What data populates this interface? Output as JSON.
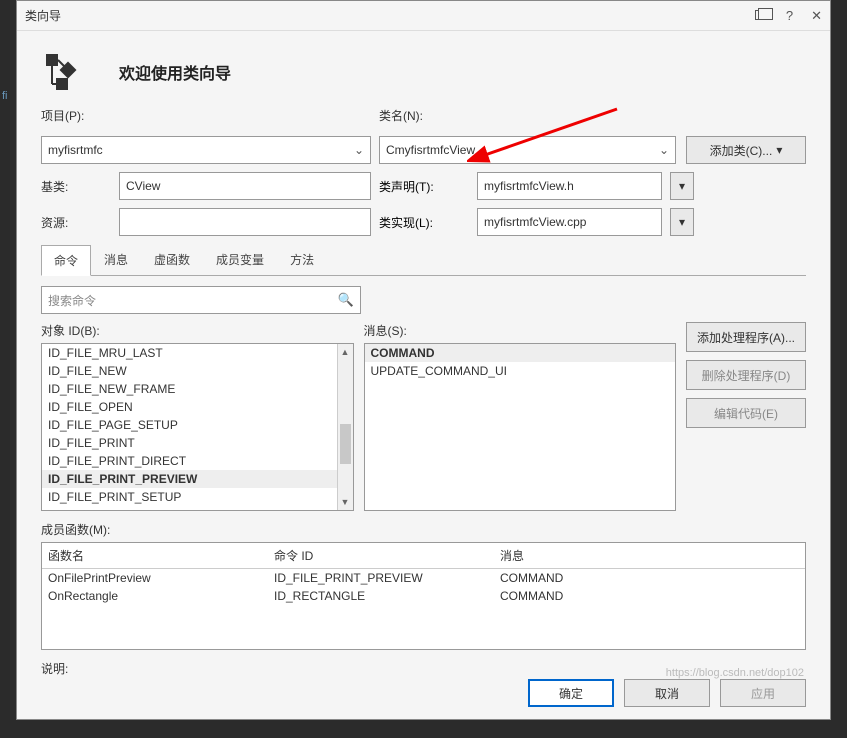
{
  "window": {
    "title": "类向导",
    "help_glyph": "?",
    "close_glyph": "✕"
  },
  "header": {
    "heading": "欢迎使用类向导"
  },
  "project": {
    "label": "项目(P):",
    "value": "myfisrtmfc"
  },
  "classname": {
    "label": "类名(N):",
    "value": "CmyfisrtmfcView"
  },
  "addclass_label": "添加类(C)...",
  "baseclass": {
    "label": "基类:",
    "value": "CView"
  },
  "decl": {
    "label": "类声明(T):",
    "value": "myfisrtmfcView.h"
  },
  "resource": {
    "label": "资源:",
    "value": ""
  },
  "impl": {
    "label": "类实现(L):",
    "value": "myfisrtmfcView.cpp"
  },
  "tabs": {
    "cmd": "命令",
    "msg": "消息",
    "virt": "虚函数",
    "memvar": "成员变量",
    "method": "方法"
  },
  "search": {
    "placeholder": "搜索命令"
  },
  "objectid": {
    "label": "对象 ID(B):",
    "items": [
      "ID_FILE_MRU_LAST",
      "ID_FILE_NEW",
      "ID_FILE_NEW_FRAME",
      "ID_FILE_OPEN",
      "ID_FILE_PAGE_SETUP",
      "ID_FILE_PRINT",
      "ID_FILE_PRINT_DIRECT",
      "ID_FILE_PRINT_PREVIEW",
      "ID_FILE_PRINT_SETUP"
    ],
    "selected_index": 7
  },
  "messages": {
    "label": "消息(S):",
    "items": [
      "COMMAND",
      "UPDATE_COMMAND_UI"
    ],
    "selected_index": 0
  },
  "side_buttons": {
    "add_handler": "添加处理程序(A)...",
    "del_handler": "删除处理程序(D)",
    "edit_code": "编辑代码(E)"
  },
  "members": {
    "label": "成员函数(M):",
    "headers": {
      "name": "函数名",
      "cmdid": "命令 ID",
      "msg": "消息"
    },
    "rows": [
      {
        "name": "OnFilePrintPreview",
        "cmdid": "ID_FILE_PRINT_PREVIEW",
        "msg": "COMMAND"
      },
      {
        "name": "OnRectangle",
        "cmdid": "ID_RECTANGLE",
        "msg": "COMMAND"
      }
    ]
  },
  "description_label": "说明:",
  "footer": {
    "ok": "确定",
    "cancel": "取消",
    "apply": "应用"
  },
  "watermark": "https://blog.csdn.net/dop102",
  "glyphs": {
    "dropdown": "⌄",
    "search": "🔍",
    "up": "▲",
    "down": "▼",
    "dropdown_solid": "▾"
  }
}
